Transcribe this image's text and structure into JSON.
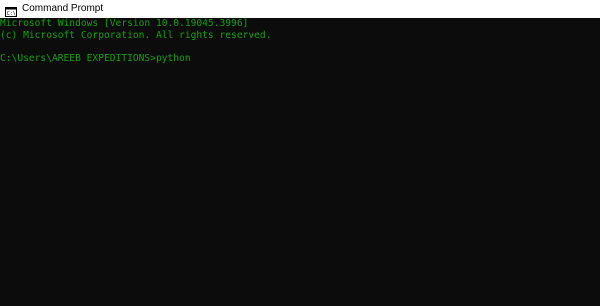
{
  "window": {
    "title": "Command Prompt",
    "icon": "cmd-icon"
  },
  "console": {
    "text_color": "#13a10e",
    "background": "#0c0c0c",
    "lines": [
      "Microsoft Windows [Version 10.0.19045.3996]",
      "(c) Microsoft Corporation. All rights reserved.",
      "",
      "C:\\Users\\AREEB EXPEDITIONS>python"
    ]
  }
}
